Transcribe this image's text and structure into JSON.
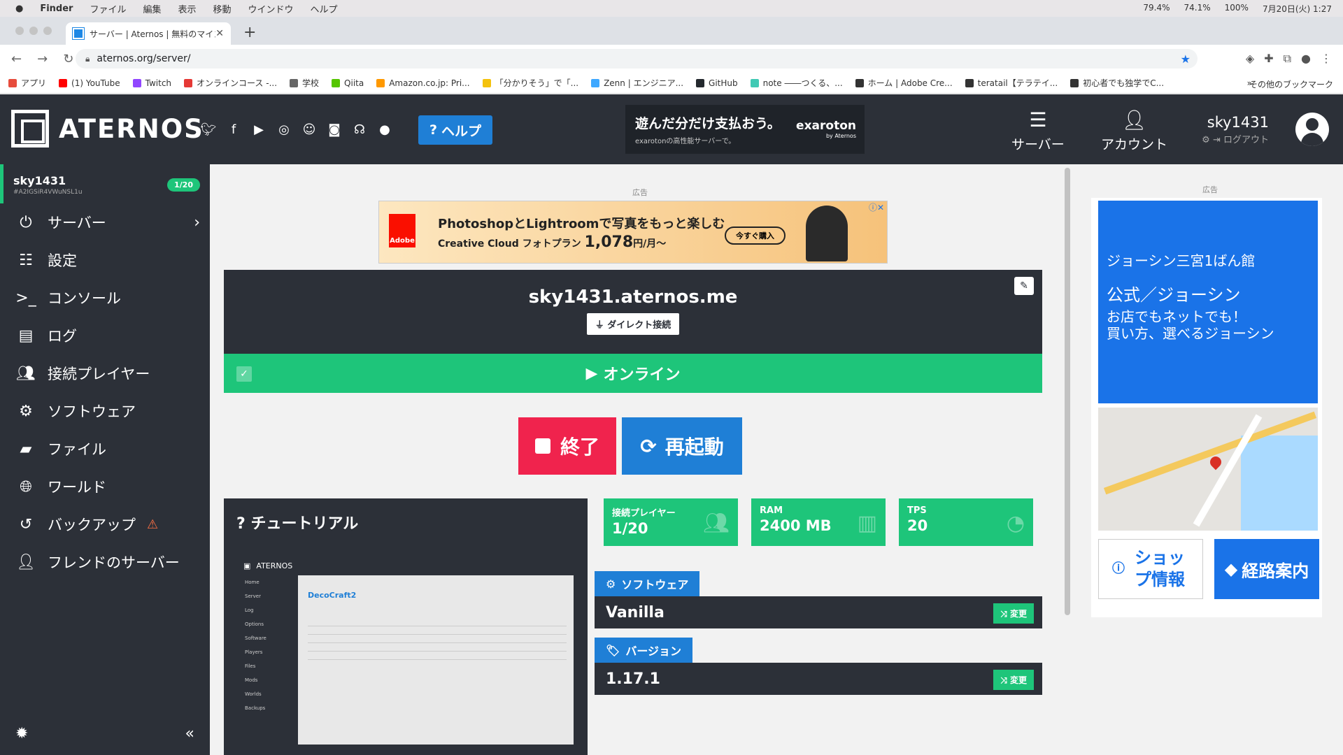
{
  "mac_menu": {
    "apple": "",
    "items": [
      "Finder",
      "ファイル",
      "編集",
      "表示",
      "移動",
      "ウインドウ",
      "ヘルプ"
    ],
    "status": [
      "79.4%",
      "74.1%",
      "100%",
      "7月20日(火) 1:27"
    ]
  },
  "browser": {
    "tab_title": "サーバー | Aternos | 無料のマイン",
    "new_tab": "+",
    "url": "aternos.org/server/",
    "bookmarks": [
      {
        "label": "アプリ",
        "color": "#e74c3c"
      },
      {
        "label": "(1) YouTube",
        "color": "#ff0000"
      },
      {
        "label": "Twitch",
        "color": "#9146ff"
      },
      {
        "label": "オンラインコース -...",
        "color": "#e53935"
      },
      {
        "label": "学校",
        "color": "#666666"
      },
      {
        "label": "Qiita",
        "color": "#55c500"
      },
      {
        "label": "Amazon.co.jp: Pri...",
        "color": "#ff9900"
      },
      {
        "label": "「分かりそう」で「...",
        "color": "#f4c20d"
      },
      {
        "label": "Zenn | エンジニア...",
        "color": "#3ea8ff"
      },
      {
        "label": "GitHub",
        "color": "#24292e"
      },
      {
        "label": "note ――つくる、...",
        "color": "#41c9b4"
      },
      {
        "label": "ホーム | Adobe Cre...",
        "color": "#333333"
      },
      {
        "label": "teratail【テラテイ...",
        "color": "#333333"
      },
      {
        "label": "初心者でも独学でC...",
        "color": "#333333"
      }
    ],
    "more": "»",
    "other_bookmarks": "その他のブックマーク"
  },
  "header": {
    "brand": "ATERNOS",
    "help_label": "ヘルプ",
    "ad_title": "遊んだ分だけ支払おう。",
    "ad_sub": "exarotonの高性能サーバーで。",
    "ad_brand": "exaroton",
    "ad_brand_sub": "by Aternos",
    "nav_servers": "サーバー",
    "nav_account": "アカウント",
    "username": "sky1431",
    "logout": "ログアウト"
  },
  "sidebar": {
    "server_name": "sky1431",
    "server_id": "#A2IGSiR4VWuNSL1u",
    "player_badge": "1/20",
    "items": [
      {
        "label": "サーバー",
        "icon": "power-icon"
      },
      {
        "label": "設定",
        "icon": "sliders-icon"
      },
      {
        "label": "コンソール",
        "icon": "terminal-icon"
      },
      {
        "label": "ログ",
        "icon": "file-icon"
      },
      {
        "label": "接続プレイヤー",
        "icon": "users-icon"
      },
      {
        "label": "ソフトウェア",
        "icon": "gears-icon"
      },
      {
        "label": "ファイル",
        "icon": "folders-icon"
      },
      {
        "label": "ワールド",
        "icon": "globe-icon"
      },
      {
        "label": "バックアップ",
        "icon": "history-icon"
      },
      {
        "label": "フレンドのサーバー",
        "icon": "user-lock-icon"
      }
    ]
  },
  "main": {
    "ad_label": "広告",
    "banner": {
      "line1": "PhotoshopとLightroomで写真をもっと楽しむ",
      "line2a": "Creative Cloud フォトプラン ",
      "price": "1,078",
      "line2b": "円/月～",
      "cta": "今すぐ購入",
      "brand": "Adobe"
    },
    "address": "sky1431.aternos.me",
    "direct_connect": "ダイレクト接続",
    "status": "オンライン",
    "stop_label": "終了",
    "restart_label": "再起動",
    "tutorial_title": "チュートリアル",
    "tutorial_img": {
      "brand": "ATERNOS",
      "heading": "DecoCraft2",
      "side": [
        "Home",
        "Server",
        "Log",
        "Options",
        "Software",
        "Players",
        "Files",
        "Mods",
        "Worlds",
        "Backups"
      ]
    },
    "stats": [
      {
        "label": "接続プレイヤー",
        "value": "1/20"
      },
      {
        "label": "RAM",
        "value": "2400 MB"
      },
      {
        "label": "TPS",
        "value": "20"
      }
    ],
    "software_tab": "ソフトウェア",
    "software_value": "Vanilla",
    "version_tab": "バージョン",
    "version_value": "1.17.1",
    "change_label": "変更"
  },
  "right_ad": {
    "label": "広告",
    "line1": "ジョーシン三宮1ばん館",
    "line2": "公式／ジョーシン",
    "line3": "お店でもネットでも！",
    "line4": "買い方、選べるジョーシン",
    "shop_info": "ショップ情報",
    "route": "経路案内"
  },
  "colors": {
    "dark": "#2c3038",
    "green": "#1ec57a",
    "blue": "#1f7fd6",
    "red": "#f0234d"
  }
}
